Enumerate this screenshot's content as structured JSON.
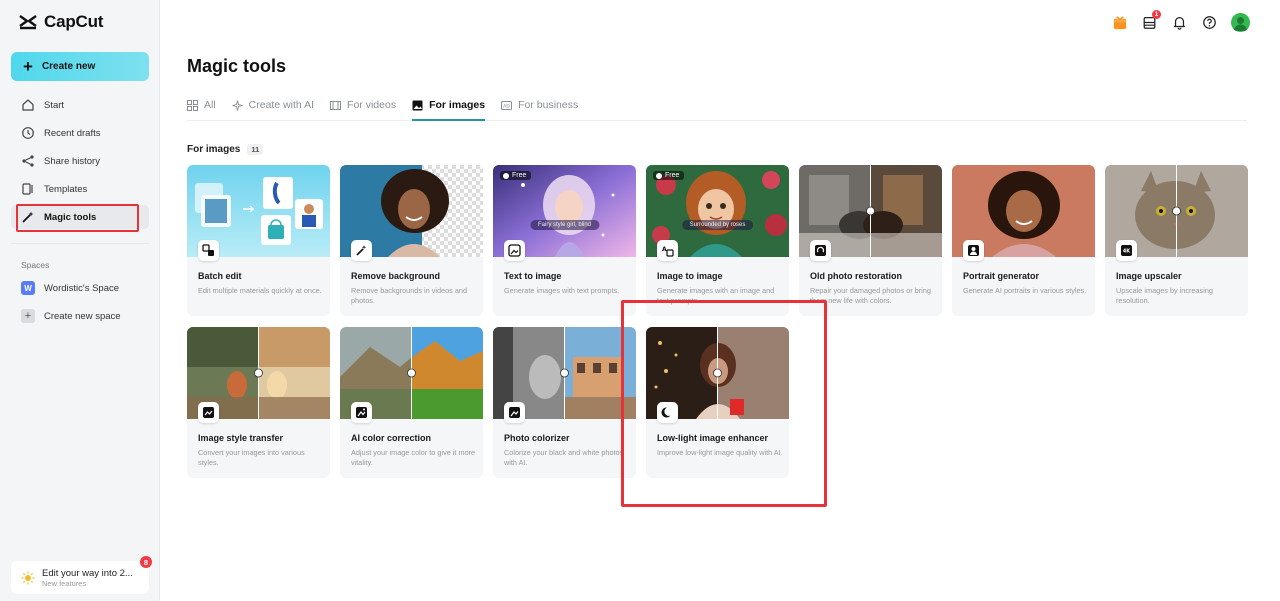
{
  "app": {
    "name": "CapCut"
  },
  "sidebar": {
    "create_label": "Create new",
    "items": [
      {
        "label": "Start",
        "icon": "home-icon"
      },
      {
        "label": "Recent drafts",
        "icon": "clock-icon"
      },
      {
        "label": "Share history",
        "icon": "share-icon"
      },
      {
        "label": "Templates",
        "icon": "templates-icon"
      },
      {
        "label": "Magic tools",
        "icon": "magic-wand-icon",
        "active": true
      }
    ],
    "spaces_title": "Spaces",
    "spaces": [
      {
        "badge": "W",
        "label": "Wordistic's Space"
      },
      {
        "badge": "+",
        "label": "Create new space"
      }
    ],
    "promo": {
      "title": "Edit your way into 2...",
      "subtitle": "New features",
      "badge": "8"
    }
  },
  "topbar": {
    "notification_count": "1"
  },
  "main": {
    "title": "Magic tools",
    "tabs": [
      {
        "label": "All",
        "icon": "grid-icon"
      },
      {
        "label": "Create with AI",
        "icon": "sparkle-icon"
      },
      {
        "label": "For videos",
        "icon": "film-icon"
      },
      {
        "label": "For images",
        "icon": "image-icon",
        "active": true
      },
      {
        "label": "For business",
        "icon": "ad-icon"
      }
    ],
    "section": {
      "title": "For images",
      "count": "11"
    },
    "free_label": "Free",
    "cards": [
      {
        "title": "Batch edit",
        "desc": "Edit multiple materials quickly at once."
      },
      {
        "title": "Remove background",
        "desc": "Remove backgrounds in videos and photos."
      },
      {
        "title": "Text to image",
        "desc": "Generate images with text prompts.",
        "free": true,
        "caption": "Fairy style girl, blind"
      },
      {
        "title": "Image to image",
        "desc": "Generate images with an image and text prompts.",
        "free": true,
        "caption": "Surrounded by roses"
      },
      {
        "title": "Old photo restoration",
        "desc": "Repair your damaged photos or bring them new life with colors."
      },
      {
        "title": "Portrait generator",
        "desc": "Generate AI portraits in various styles."
      },
      {
        "title": "Image upscaler",
        "desc": "Upscale images by increasing resolution."
      },
      {
        "title": "Image style transfer",
        "desc": "Convert your images into various styles."
      },
      {
        "title": "AI color correction",
        "desc": "Adjust your image color to give it more vitality."
      },
      {
        "title": "Photo colorizer",
        "desc": "Colorize your black and white photos with AI."
      },
      {
        "title": "Low-light image enhancer",
        "desc": "Improve low-light image quality with AI."
      }
    ]
  },
  "colors": {
    "accent": "#4fd8ec",
    "highlight_box": "#e8323a",
    "active_tab_underline": "#2a8fa8"
  }
}
